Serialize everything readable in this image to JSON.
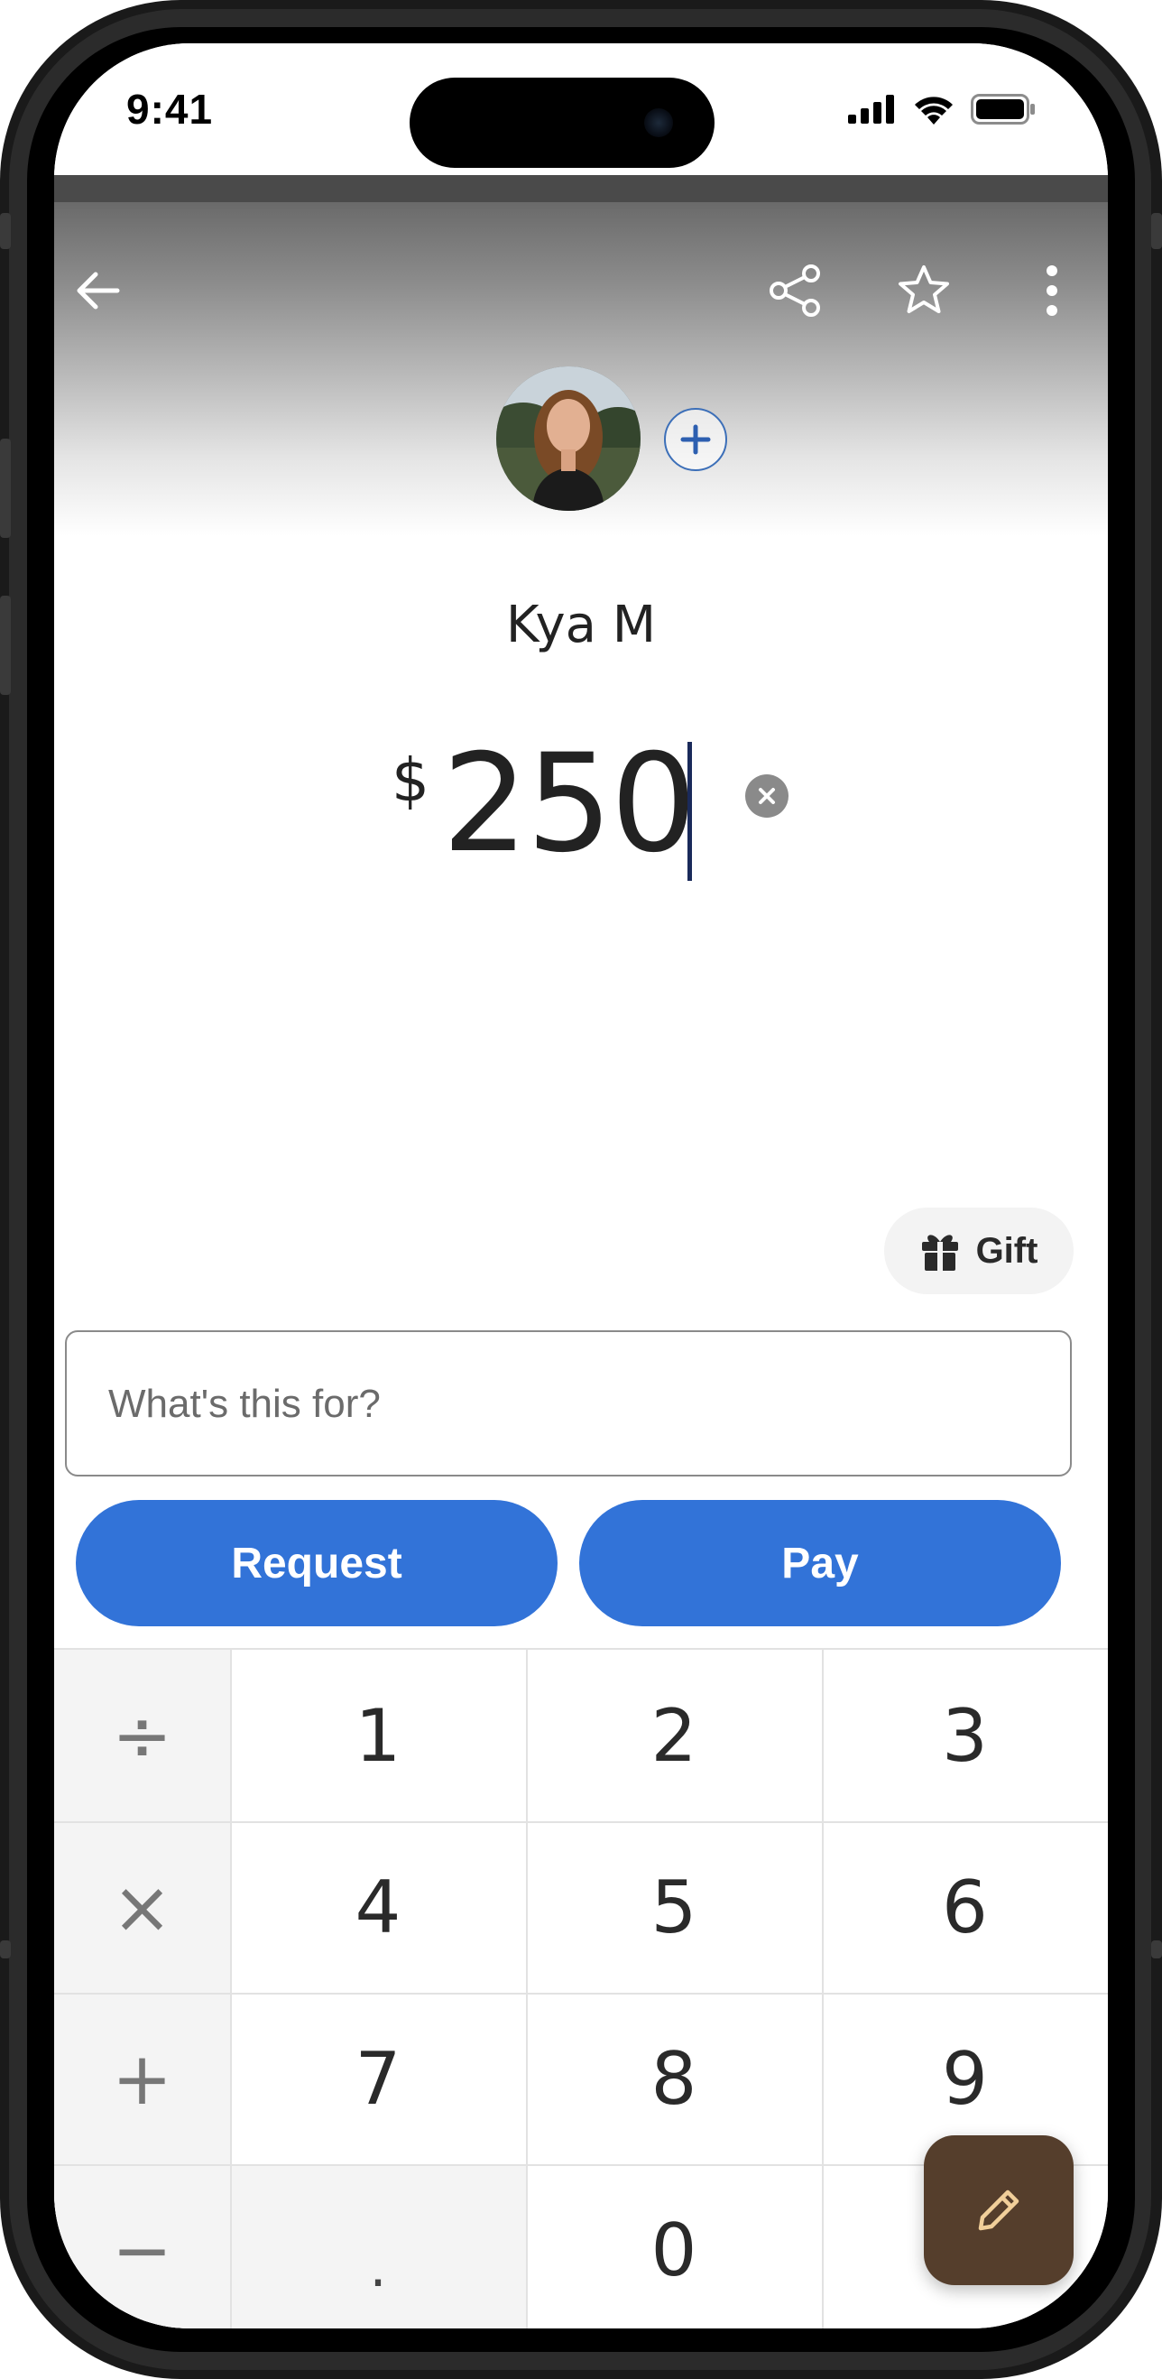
{
  "status_bar": {
    "time": "9:41",
    "icons": [
      "cellular-signal-icon",
      "wifi-icon",
      "battery-icon"
    ]
  },
  "header": {
    "back_icon": "arrow-left-icon",
    "share_icon": "share-icon",
    "favorite_icon": "star-outline-icon",
    "more_icon": "more-vertical-icon"
  },
  "recipient": {
    "name": "Kya M",
    "add_icon": "plus-circle-icon"
  },
  "amount": {
    "currency_symbol": "$",
    "value": "250",
    "clear_icon": "clear-circle-icon"
  },
  "gift": {
    "label": "Gift",
    "icon": "gift-icon"
  },
  "note": {
    "placeholder": "What's this for?",
    "value": ""
  },
  "actions": {
    "request_label": "Request",
    "pay_label": "Pay"
  },
  "keypad": {
    "operators": [
      "÷",
      "×",
      "+",
      "−"
    ],
    "rows": [
      [
        "1",
        "2",
        "3"
      ],
      [
        "4",
        "5",
        "6"
      ],
      [
        "7",
        "8",
        "9"
      ],
      [
        ".",
        "0",
        ""
      ]
    ]
  },
  "fab": {
    "icon": "pencil-icon"
  },
  "colors": {
    "accent": "#3273d8",
    "fab": "#553e2c",
    "text": "#222222"
  }
}
